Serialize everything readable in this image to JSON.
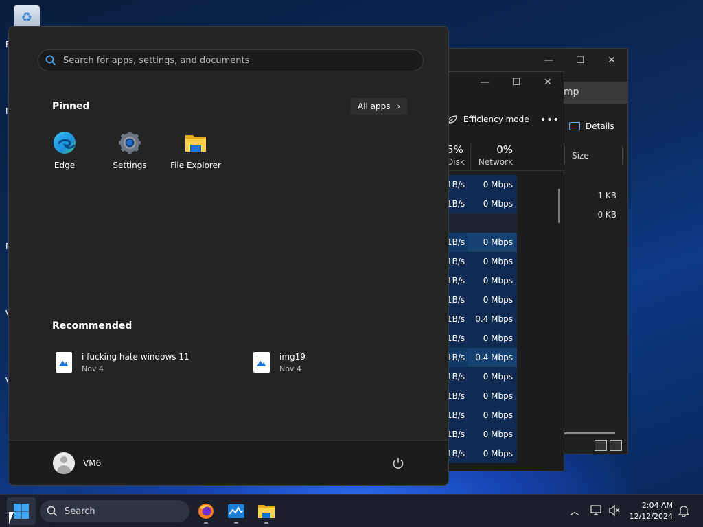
{
  "desktop": {
    "left_letters": [
      "F",
      "I",
      "N",
      "V",
      "V"
    ]
  },
  "file_explorer": {
    "address_fragment": "mp",
    "details_label": "Details",
    "column_size": "Size",
    "sizes": [
      "1 KB",
      "0 KB"
    ]
  },
  "task_manager": {
    "efficiency_mode": "Efficiency mode",
    "more": "•••",
    "disk_pct": "5%",
    "disk_label": "Disk",
    "network_pct": "0%",
    "network_label": "Network",
    "rows": [
      {
        "disk": "1B/s",
        "net": "0 Mbps"
      },
      {
        "disk": "1B/s",
        "net": "0 Mbps"
      },
      {
        "disk": "",
        "net": ""
      },
      {
        "disk": "1B/s",
        "net": "0 Mbps"
      },
      {
        "disk": "1B/s",
        "net": "0 Mbps"
      },
      {
        "disk": "1B/s",
        "net": "0 Mbps"
      },
      {
        "disk": "1B/s",
        "net": "0 Mbps"
      },
      {
        "disk": "1B/s",
        "net": "0.4 Mbps"
      },
      {
        "disk": "1B/s",
        "net": "0 Mbps"
      },
      {
        "disk": "1B/s",
        "net": "0.4 Mbps"
      },
      {
        "disk": "1B/s",
        "net": "0 Mbps"
      },
      {
        "disk": "1B/s",
        "net": "0 Mbps"
      },
      {
        "disk": "1B/s",
        "net": "0 Mbps"
      },
      {
        "disk": "1B/s",
        "net": "0 Mbps"
      },
      {
        "disk": "1B/s",
        "net": "0 Mbps"
      }
    ]
  },
  "start_menu": {
    "search_placeholder": "Search for apps, settings, and documents",
    "pinned_title": "Pinned",
    "all_apps_label": "All apps",
    "pinned": [
      {
        "label": "Edge",
        "icon": "edge-icon"
      },
      {
        "label": "Settings",
        "icon": "settings-icon"
      },
      {
        "label": "File Explorer",
        "icon": "folder-icon"
      }
    ],
    "recommended_title": "Recommended",
    "recommended": [
      {
        "name": "i fucking hate windows 11",
        "date": "Nov 4"
      },
      {
        "name": "img19",
        "date": "Nov 4"
      }
    ],
    "user_name": "VM6"
  },
  "taskbar": {
    "search_label": "Search",
    "time": "2:04 AM",
    "date": "12/12/2024"
  },
  "colors": {
    "accent": "#1a73d9",
    "start_bg": "#242424",
    "taskbar_bg": "#1a1f2a",
    "tm_highlight": "#0f2b52"
  }
}
